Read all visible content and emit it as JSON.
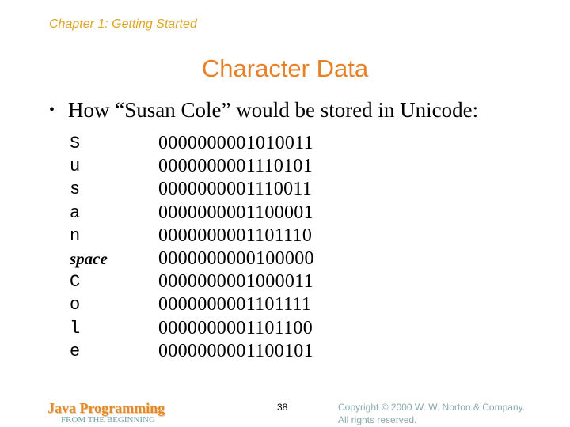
{
  "header": {
    "chapter": "Chapter 1: Getting Started",
    "title": "Character Data"
  },
  "bullet": {
    "marker": "•",
    "text": "How “Susan Cole” would be stored in Unicode:"
  },
  "encoding_table": [
    {
      "char": "S",
      "bits": "0000000001010011",
      "italic": false
    },
    {
      "char": "u",
      "bits": "0000000001110101",
      "italic": false
    },
    {
      "char": "s",
      "bits": "0000000001110011",
      "italic": false
    },
    {
      "char": "a",
      "bits": "0000000001100001",
      "italic": false
    },
    {
      "char": "n",
      "bits": "0000000001101110",
      "italic": false
    },
    {
      "char": "space",
      "bits": "0000000000100000",
      "italic": true
    },
    {
      "char": "C",
      "bits": "0000000001000011",
      "italic": false
    },
    {
      "char": "o",
      "bits": "0000000001101111",
      "italic": false
    },
    {
      "char": "l",
      "bits": "0000000001101100",
      "italic": false
    },
    {
      "char": "e",
      "bits": "0000000001100101",
      "italic": false
    }
  ],
  "footer": {
    "brand": "Java Programming",
    "subtitle": "FROM THE BEGINNING",
    "page_number": "38",
    "copyright_line1": "Copyright © 2000 W. W. Norton & Company.",
    "copyright_line2": "All rights reserved."
  },
  "colors": {
    "chapter": "#e0a526",
    "title": "#ea8026",
    "brand": "#e48a2a",
    "subtitle": "#6f9fa8",
    "copyright": "#8aa8ad"
  }
}
